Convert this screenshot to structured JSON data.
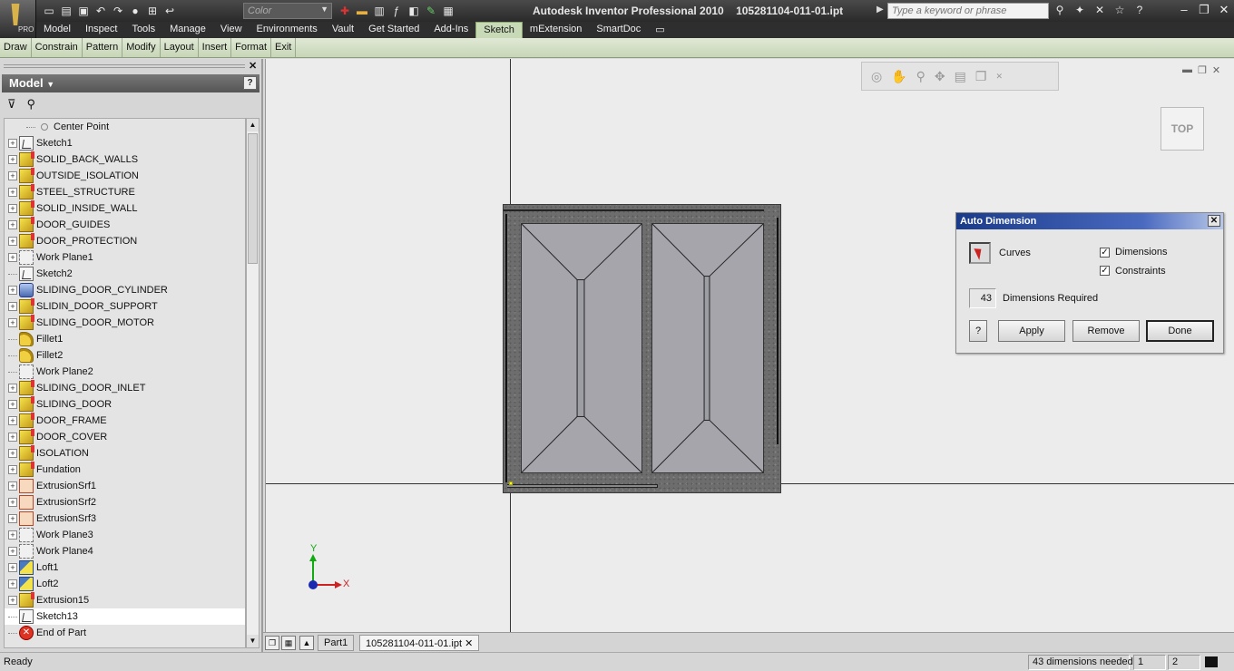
{
  "title_bar": {
    "app_title": "Autodesk Inventor Professional 2010",
    "file_name": "105281104-011-01.ipt",
    "pro_label": "PRO",
    "color_combo": "Color",
    "search_placeholder": "Type a keyword or phrase"
  },
  "ribbon_tabs": [
    "Model",
    "Inspect",
    "Tools",
    "Manage",
    "View",
    "Environments",
    "Vault",
    "Get Started",
    "Add-Ins",
    "Sketch",
    "mExtension",
    "SmartDoc"
  ],
  "active_tab": "Sketch",
  "panel_bar": [
    "Draw",
    "Constrain",
    "Pattern",
    "Modify",
    "Layout",
    "Insert",
    "Format",
    "Exit"
  ],
  "browser": {
    "header": "Model",
    "tree": [
      {
        "label": "Center Point",
        "icon": "point-icon",
        "expandable": false
      },
      {
        "label": "Sketch1",
        "icon": "sketch-icon",
        "expandable": true
      },
      {
        "label": "SOLID_BACK_WALLS",
        "icon": "extrusion-icon",
        "expandable": true
      },
      {
        "label": "OUTSIDE_ISOLATION",
        "icon": "extrusion-icon",
        "expandable": true
      },
      {
        "label": "STEEL_STRUCTURE",
        "icon": "extrusion-icon",
        "expandable": true
      },
      {
        "label": "SOLID_INSIDE_WALL",
        "icon": "extrusion-icon",
        "expandable": true
      },
      {
        "label": "DOOR_GUIDES",
        "icon": "extrusion-icon",
        "expandable": true
      },
      {
        "label": "DOOR_PROTECTION",
        "icon": "extrusion-icon",
        "expandable": true
      },
      {
        "label": "Work Plane1",
        "icon": "work-plane-icon",
        "expandable": true
      },
      {
        "label": "Sketch2",
        "icon": "sketch-icon",
        "expandable": false
      },
      {
        "label": "SLIDING_DOOR_CYLINDER",
        "icon": "cylinder-icon",
        "expandable": true
      },
      {
        "label": "SLIDIN_DOOR_SUPPORT",
        "icon": "extrusion-icon",
        "expandable": true
      },
      {
        "label": "SLIDING_DOOR_MOTOR",
        "icon": "extrusion-icon",
        "expandable": true
      },
      {
        "label": "Fillet1",
        "icon": "fillet-icon",
        "expandable": false
      },
      {
        "label": "Fillet2",
        "icon": "fillet-icon",
        "expandable": false
      },
      {
        "label": "Work Plane2",
        "icon": "work-plane-icon",
        "expandable": false
      },
      {
        "label": "SLIDING_DOOR_INLET",
        "icon": "extrusion-icon",
        "expandable": true
      },
      {
        "label": "SLIDING_DOOR",
        "icon": "extrusion-icon",
        "expandable": true
      },
      {
        "label": "DOOR_FRAME",
        "icon": "extrusion-icon",
        "expandable": true
      },
      {
        "label": "DOOR_COVER",
        "icon": "extrusion-icon",
        "expandable": true
      },
      {
        "label": "ISOLATION",
        "icon": "extrusion-icon",
        "expandable": true
      },
      {
        "label": "Fundation",
        "icon": "extrusion-icon",
        "expandable": true
      },
      {
        "label": "ExtrusionSrf1",
        "icon": "surface-icon",
        "expandable": true
      },
      {
        "label": "ExtrusionSrf2",
        "icon": "surface-icon",
        "expandable": true
      },
      {
        "label": "ExtrusionSrf3",
        "icon": "surface-icon",
        "expandable": true
      },
      {
        "label": "Work Plane3",
        "icon": "work-plane-icon",
        "expandable": true
      },
      {
        "label": "Work Plane4",
        "icon": "work-plane-icon",
        "expandable": true
      },
      {
        "label": "Loft1",
        "icon": "loft-icon",
        "expandable": true
      },
      {
        "label": "Loft2",
        "icon": "loft-icon",
        "expandable": true
      },
      {
        "label": "Extrusion15",
        "icon": "extrusion-icon",
        "expandable": true
      },
      {
        "label": "Sketch13",
        "icon": "sketch-icon",
        "expandable": false,
        "selected": true
      },
      {
        "label": "End of Part",
        "icon": "end-of-part-icon",
        "expandable": false
      }
    ]
  },
  "graphics": {
    "viewcube_label": "TOP",
    "triad": {
      "y_label": "Y",
      "x_label": "X"
    }
  },
  "auto_dimension": {
    "title": "Auto Dimension",
    "curves_label": "Curves",
    "dimensions_label": "Dimensions",
    "dimensions_checked": true,
    "constraints_label": "Constraints",
    "constraints_checked": true,
    "required_count": "43",
    "required_label": "Dimensions Required",
    "help_label": "?",
    "apply_label": "Apply",
    "remove_label": "Remove",
    "done_label": "Done"
  },
  "doc_tabs": [
    "Part1",
    "105281104-011-01.ipt"
  ],
  "status_bar": {
    "ready": "Ready",
    "dims_needed": "43 dimensions needed",
    "field1": "1",
    "field2": "2"
  },
  "colors": {
    "ribbon_dark": "#2e2e2e",
    "sketch_tab": "#c8d9b8",
    "dialog_title": "#1a3a8a",
    "viewport_bg": "#ececec"
  }
}
